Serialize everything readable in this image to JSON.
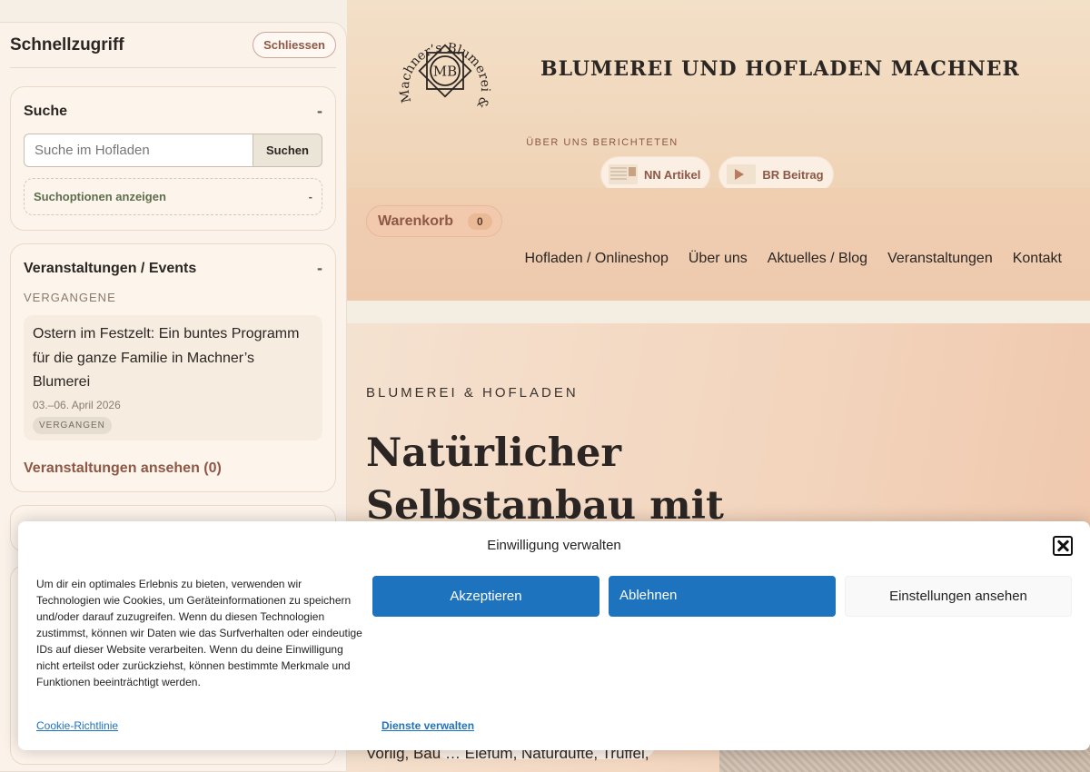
{
  "sidebar": {
    "title": "Schnellzugriff",
    "close_label": "Schliessen",
    "search": {
      "title": "Suche",
      "toggle": "-",
      "placeholder": "Suche im Hofladen",
      "button_label": "Suchen",
      "options_label": "Suchoptionen anzeigen",
      "options_toggle": "-"
    },
    "events": {
      "title": "Veranstaltungen / Events",
      "toggle": "-",
      "section_label": "VERGANGENE",
      "items": [
        {
          "title": "Ostern im Festzelt: Ein buntes Programm für die ganze Familie in Machner’s Blumerei",
          "date": "03.–06. April 2026",
          "badge": "VERGANGEN"
        }
      ],
      "link_label": "Veranstaltungen ansehen (0)"
    }
  },
  "header": {
    "logo_text": "Machner’s Blumerei & Hofladen",
    "logo_monogram": "MB",
    "site_name": "BLUMEREI UND HOFLADEN MACHNER",
    "press_label": "ÜBER UNS BERICHTETEN",
    "press": [
      {
        "label": "NN Artikel",
        "icon": "newspaper-thumbnail-icon"
      },
      {
        "label": "BR Beitrag",
        "icon": "video-thumbnail-icon"
      }
    ],
    "cart_label": "Warenkorb",
    "cart_count": "0",
    "nav": [
      "Hofladen / Onlineshop",
      "Über uns",
      "Aktuelles / Blog",
      "Veranstaltungen",
      "Kontakt"
    ]
  },
  "hero": {
    "eyebrow": "BLUMEREI & HOFLADEN",
    "title": "Natürlicher Selbstanbau mit",
    "body": "Vorlig, Bau … Elefüm, Naturdüfte, Trüffel, Räucherwerk, Salz"
  },
  "cookie": {
    "title": "Einwilligung verwalten",
    "text": "Um dir ein optimales Erlebnis zu bieten, verwenden wir Technologien wie Cookies, um Geräteinformationen zu speichern und/oder darauf zuzugreifen. Wenn du diesen Technologien zustimmst, können wir Daten wie das Surfverhalten oder eindeutige IDs auf dieser Website verarbeiten. Wenn du deine Einwilligung nicht erteilst oder zurückziehst, können bestimmte Merkmale und Funktionen beeinträchtigt werden.",
    "accept_label": "Akzeptieren",
    "deny_label": "Ablehnen",
    "settings_label": "Einstellungen ansehen",
    "policy_link": "Cookie-Richtlinie",
    "services_link": "Dienste verwalten"
  },
  "colors": {
    "accent": "#8d5846",
    "button_primary": "#1e73be",
    "header_bg": "#f3e0c8",
    "nav_bg": "#f0ceb0"
  }
}
